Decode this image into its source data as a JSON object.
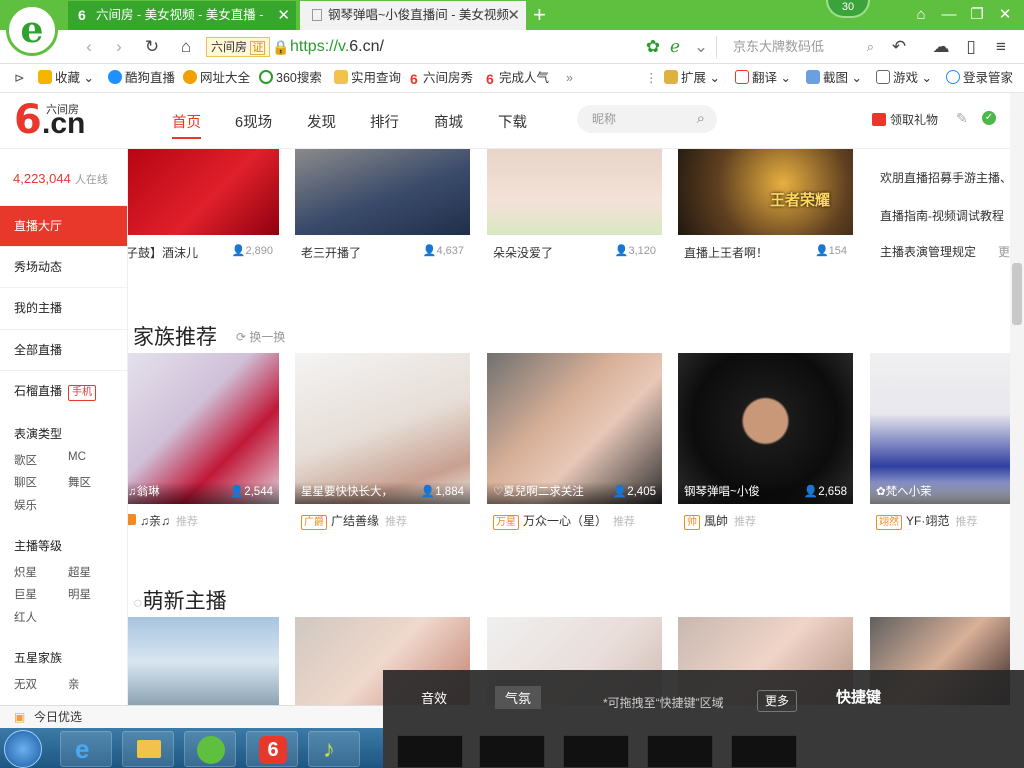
{
  "browser": {
    "tabs": [
      {
        "title": "六间房 - 美女视频 - 美女直播 - ",
        "active": true
      },
      {
        "title": "钢琴弹唱~小俊直播间 - 美女视频",
        "active": false
      }
    ],
    "badge_count": "30",
    "site_badge": "六间房",
    "site_badge_cert": "证",
    "url_scheme": "https://v.",
    "url_domain": "6.cn/",
    "search_placeholder": "京东大牌数码低",
    "bookmarks": [
      "收藏",
      "酷狗直播",
      "网址大全",
      "360搜索",
      "实用查询",
      "六间房秀",
      "完成人气",
      "扩展",
      "翻译",
      "截图",
      "游戏",
      "登录管家"
    ]
  },
  "site": {
    "logo_small": "六间房",
    "logo_num": "6",
    "logo_cn": ".cn",
    "nav": [
      "首页",
      "6现场",
      "发现",
      "排行",
      "商城",
      "下载"
    ],
    "nav_active": 0,
    "search_placeholder": "昵称",
    "gift_label": "领取礼物"
  },
  "sidebar": {
    "online_count": "4,223,044",
    "online_label": "人在线",
    "items": [
      "直播大厅",
      "秀场动态",
      "我的主播",
      "全部直播",
      "石榴直播"
    ],
    "mobile_badge": "手机",
    "perf_type_title": "表演类型",
    "perf_types": [
      "歌区",
      "MC",
      "聊区",
      "舞区",
      "娱乐"
    ],
    "level_title": "主播等级",
    "levels": [
      "炽星",
      "超星",
      "巨星",
      "明星",
      "红人"
    ],
    "family_title": "五星家族",
    "families": [
      "无双",
      "亲"
    ]
  },
  "top_row": [
    {
      "caption": "子鼓】酒沫儿",
      "count": "2,890"
    },
    {
      "caption": "老三开播了",
      "count": "4,637"
    },
    {
      "caption": "朵朵没爱了",
      "count": "3,120"
    },
    {
      "caption": "直播上王者啊！",
      "count": "154"
    }
  ],
  "top_row_game_text": "王者荣耀",
  "right_links": [
    "欢朋直播招募手游主播、经",
    "直播指南-视频调试教程",
    "主播表演管理规定"
  ],
  "right_more": "更",
  "family": {
    "title": "家族推荐",
    "swap": "换一换",
    "recommend": "推荐",
    "cards": [
      {
        "name": "♫翁琳",
        "count": "2,544",
        "tag": "",
        "family": "♫亲♫"
      },
      {
        "name": "星星要快快长大，",
        "count": "1,884",
        "tag": "广爵",
        "family": "广结善缘"
      },
      {
        "name": "♡夏兒啊二求关注",
        "count": "2,405",
        "tag": "万星",
        "family": "万众一心（星）"
      },
      {
        "name": "钢琴弹唱~小俊",
        "count": "2,658",
        "tag": "帅",
        "family": "風帥"
      },
      {
        "name": "✿梵へ小茉",
        "count": "",
        "tag": "翊然",
        "family": "YF·翊范"
      }
    ]
  },
  "newbie": {
    "title": "萌新主播"
  },
  "shortcut_panel": {
    "tabs": [
      "音效",
      "气氛"
    ],
    "hint": "*可拖拽至“快捷键”区域",
    "more": "更多",
    "title": "快捷键"
  },
  "statusbar": {
    "text": "今日优选"
  },
  "colors": {
    "brand_red": "#e8382c",
    "browser_green": "#5fbf3f"
  }
}
